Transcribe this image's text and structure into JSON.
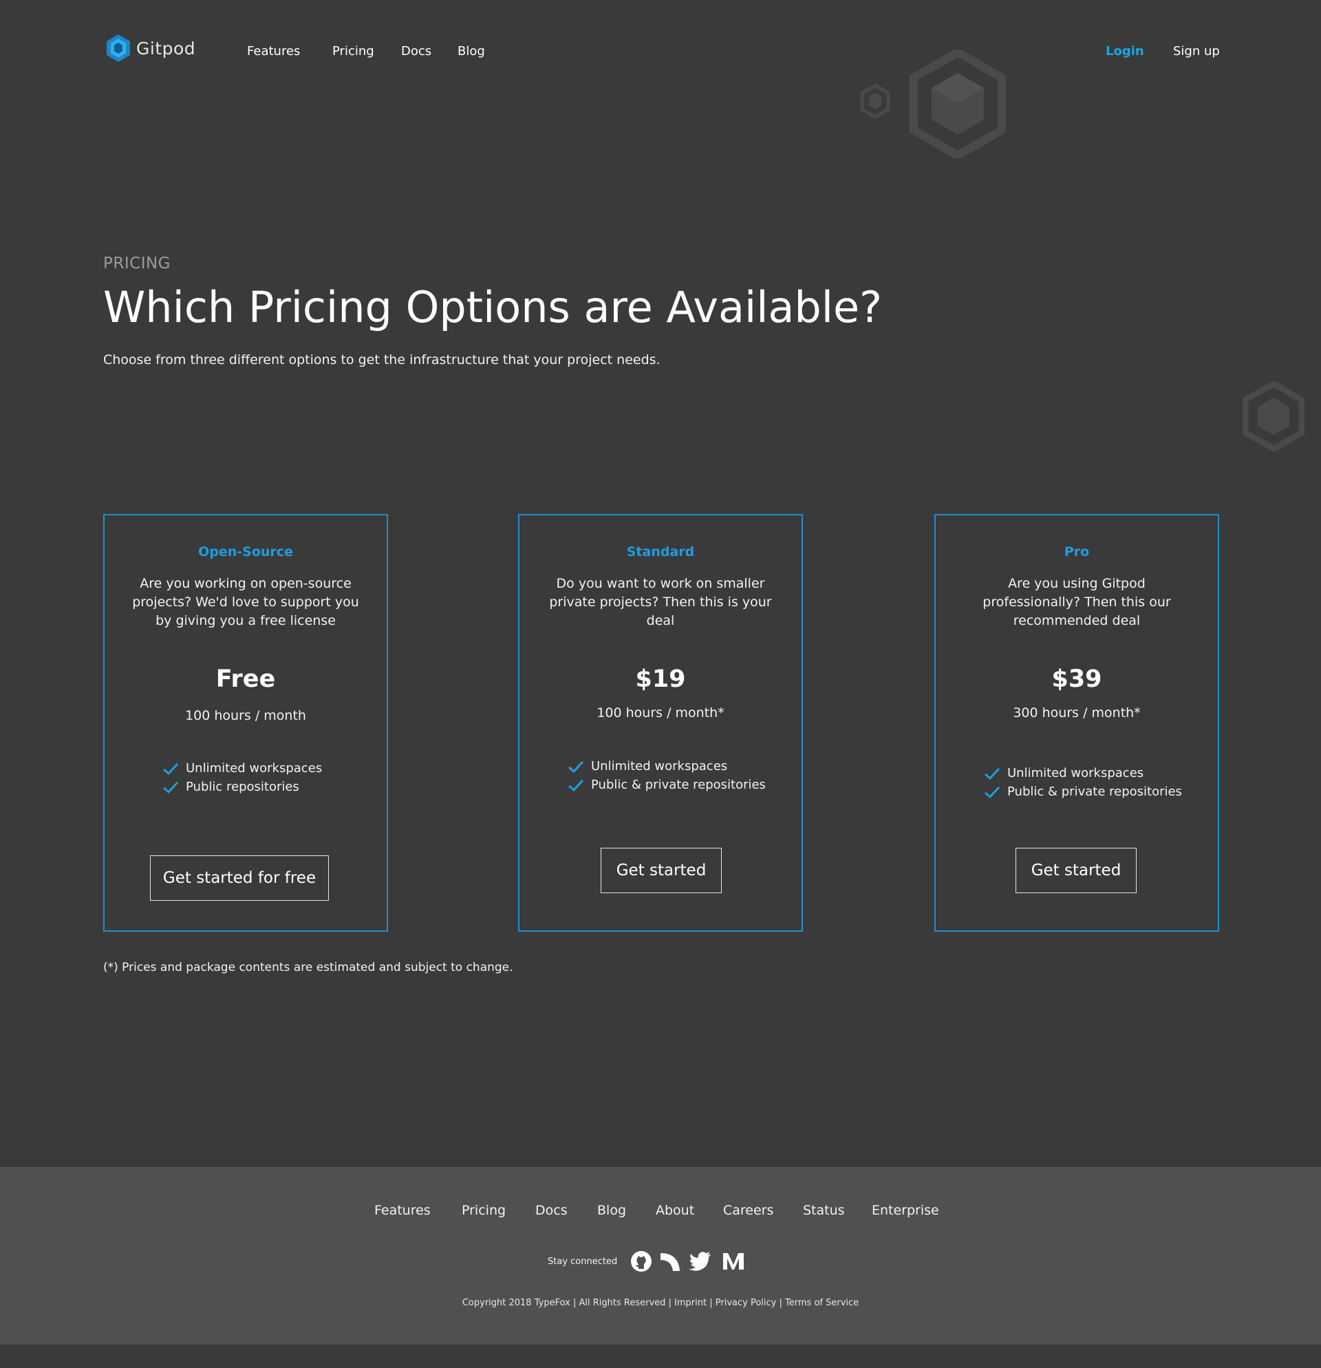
{
  "header": {
    "brand": "Gitpod",
    "nav": [
      {
        "label": "Features"
      },
      {
        "label": "Pricing"
      },
      {
        "label": "Docs"
      },
      {
        "label": "Blog"
      }
    ],
    "login": "Login",
    "signup": "Sign up"
  },
  "hero": {
    "eyebrow": "PRICING",
    "title": "Which Pricing Options are Available?",
    "subtitle": "Choose from three different options to get the infrastructure that your project needs."
  },
  "plans": [
    {
      "name": "Open-Source",
      "description": "Are you working on open-source projects? We'd love to support you by giving you a free license",
      "price": "Free",
      "hours": "100 hours / month",
      "features": [
        "Unlimited workspaces",
        "Public  repositories"
      ],
      "cta": "Get started for free"
    },
    {
      "name": "Standard",
      "description": "Do you want to work on smaller private projects? Then this is your deal",
      "price": "$19",
      "hours": "100 hours / month*",
      "features": [
        "Unlimited workspaces",
        "Public & private repositories"
      ],
      "cta": "Get started"
    },
    {
      "name": "Pro",
      "description": "Are you using Gitpod professionally? Then this our recommended deal",
      "price": "$39",
      "hours": "300 hours / month*",
      "features": [
        "Unlimited workspaces",
        "Public & private repositories"
      ],
      "cta": "Get started"
    }
  ],
  "footnote": "(*) Prices and package contents are estimated and subject to change.",
  "footer": {
    "nav": [
      {
        "label": "Features"
      },
      {
        "label": "Pricing"
      },
      {
        "label": "Docs"
      },
      {
        "label": "Blog"
      },
      {
        "label": "About"
      },
      {
        "label": "Careers"
      },
      {
        "label": "Status"
      },
      {
        "label": "Enterprise"
      }
    ],
    "stay_connected": "Stay connected",
    "social_icons": [
      "github-icon",
      "spectrum-icon",
      "twitter-icon",
      "medium-icon"
    ],
    "copyright": "Copyright 2018 TypeFox",
    "rights": "All Rights Reserved",
    "imprint": "Imprint",
    "privacy": "Privacy Policy",
    "terms": "Terms of Service"
  },
  "colors": {
    "background": "#3a3a3b",
    "footer_background": "#505050",
    "accent": "#1f9ee0",
    "card_border": "#1f8fd0"
  }
}
